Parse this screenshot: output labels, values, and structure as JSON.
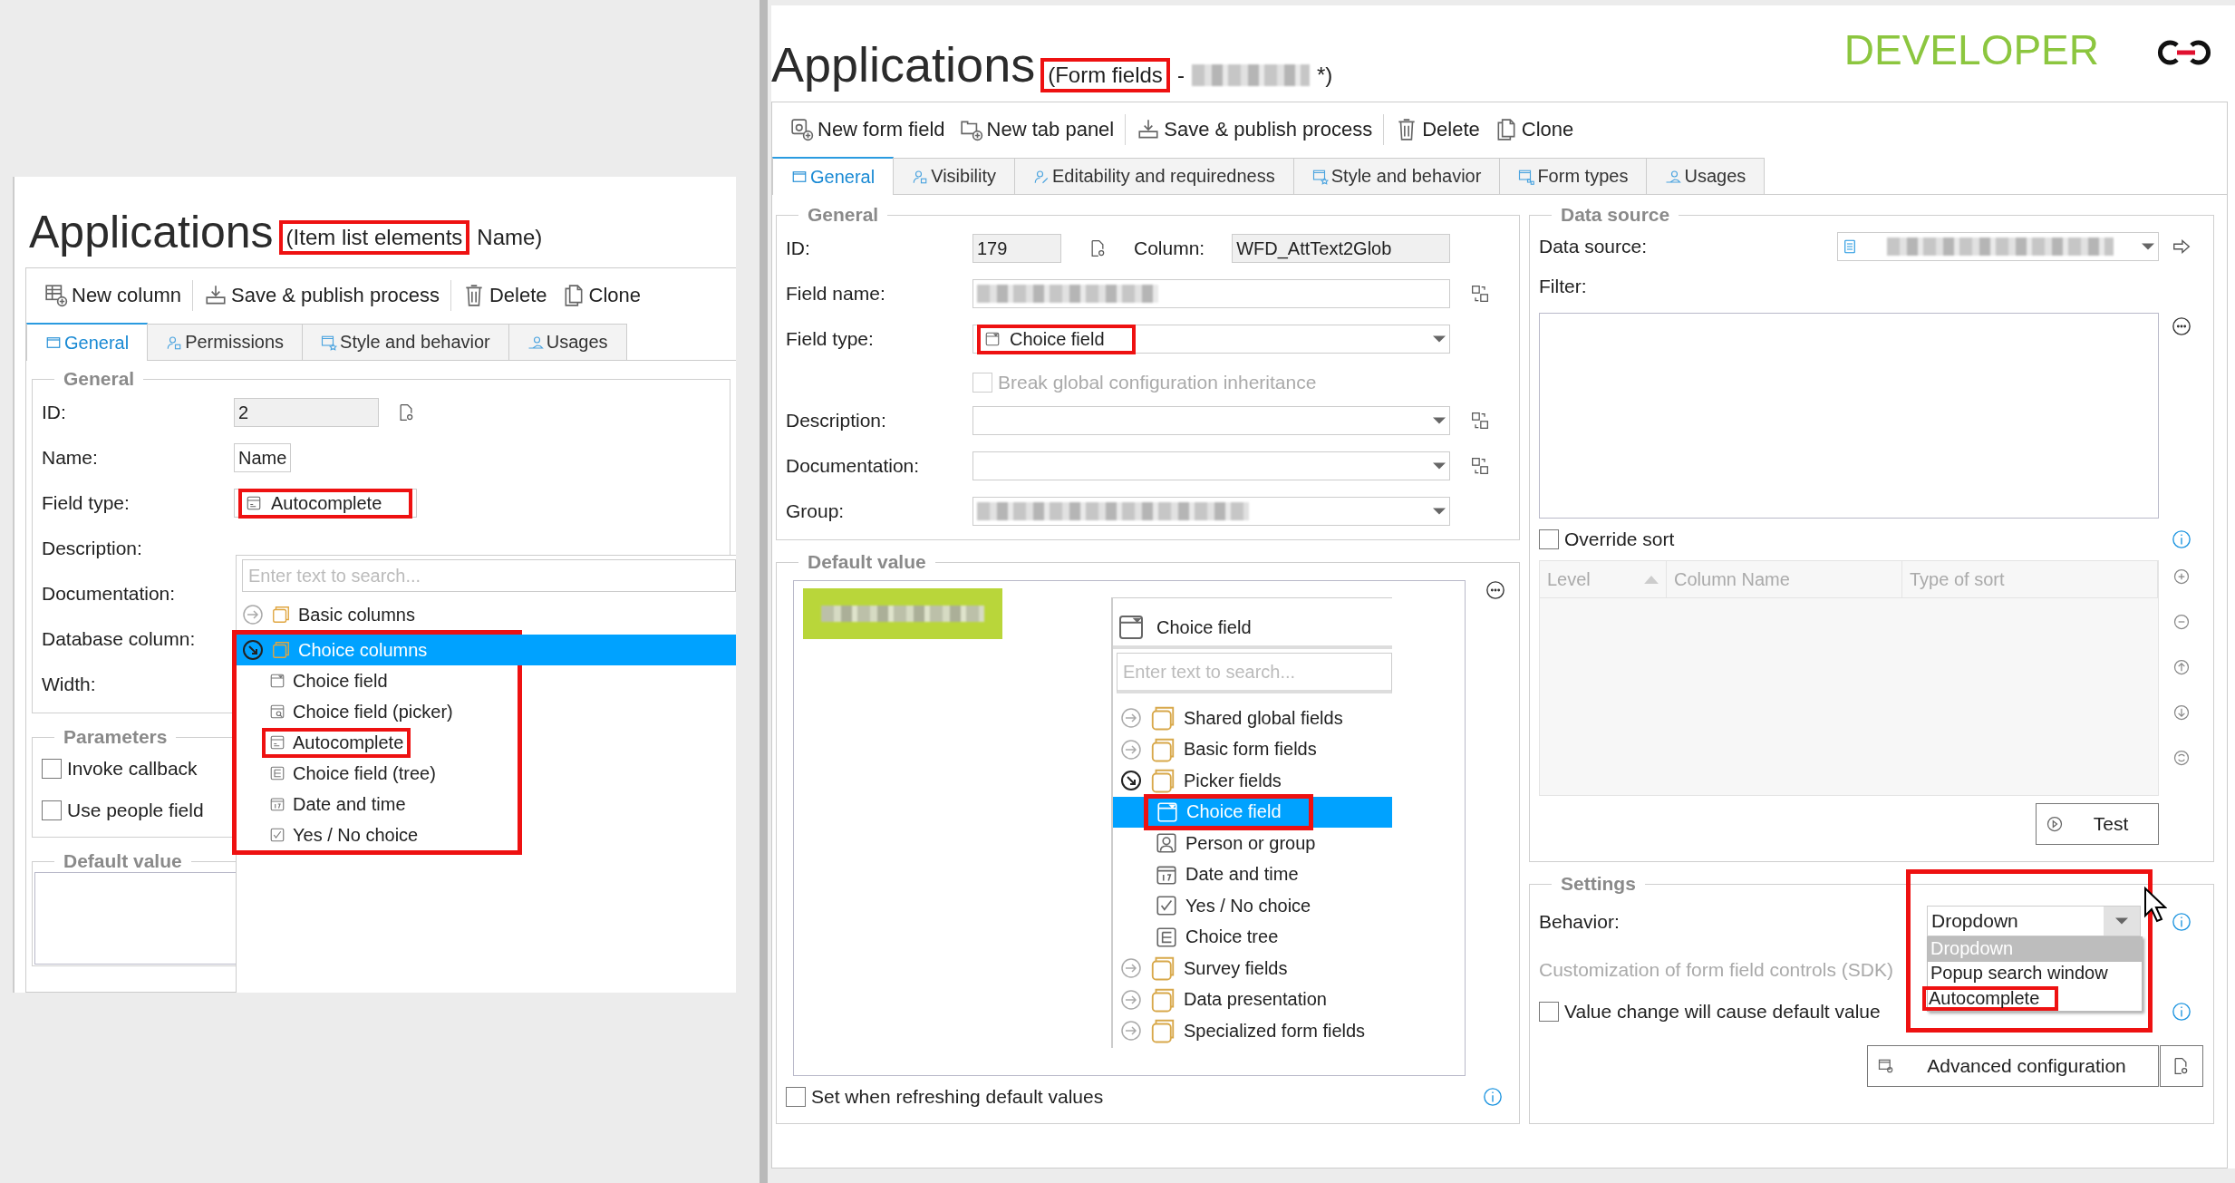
{
  "left": {
    "title": "Applications",
    "subtitle": [
      {
        "kind": "text",
        "text": "(Item list elements",
        "highlighted": true
      },
      {
        "kind": "text",
        "text": "Name)",
        "highlighted": false
      }
    ],
    "toolbar": [
      [
        {
          "label": "New column"
        }
      ],
      [
        {
          "label": "Save & publish process"
        }
      ],
      [
        {
          "label": "Delete"
        },
        {
          "label": "Clone"
        }
      ]
    ],
    "tabs": [
      {
        "label": "General",
        "selected": true
      },
      {
        "label": "Permissions",
        "selected": false
      },
      {
        "label": "Style and behavior",
        "selected": false
      },
      {
        "label": "Usages",
        "selected": false
      }
    ],
    "general": {
      "title": "General",
      "rows": [
        {
          "kind": "id",
          "label": "ID:",
          "field": {
            "kind": "readonly",
            "value": "2"
          }
        },
        {
          "kind": "field",
          "label": "Name:",
          "field": {
            "kind": "text",
            "value": "Name"
          }
        },
        {
          "kind": "field",
          "label": "Field type:",
          "field": {
            "kind": "combo",
            "value": "Autocomplete",
            "highlighted": true
          }
        },
        {
          "kind": "field",
          "label": "Description:"
        },
        {
          "kind": "field",
          "label": "Documentation:"
        },
        {
          "kind": "field",
          "label": "Database column:"
        },
        {
          "kind": "field",
          "label": "Width:"
        }
      ]
    },
    "parameters": {
      "title": "Parameters",
      "checks": [
        {
          "label": "Invoke callback",
          "checked": false
        },
        {
          "label": "Use people field",
          "checked": false
        }
      ]
    },
    "default_value": {
      "title": "Default value"
    },
    "dropdown": {
      "placeholder": "Enter text to search...",
      "tree": [
        {
          "label": "Basic columns",
          "expanded": false,
          "selected": false,
          "highlighted": false
        },
        {
          "label": "Choice columns",
          "expanded": true,
          "selected": true,
          "highlighted": true,
          "children": [
            {
              "label": "Choice field",
              "highlighted": false
            },
            {
              "label": "Choice field (picker)",
              "highlighted": false
            },
            {
              "label": "Autocomplete",
              "highlighted": true
            },
            {
              "label": "Choice field (tree)",
              "highlighted": false
            },
            {
              "label": "Date and time",
              "highlighted": false
            },
            {
              "label": "Yes / No choice",
              "highlighted": false
            }
          ]
        }
      ]
    }
  },
  "right": {
    "title": "Applications",
    "subtitle": [
      {
        "kind": "text",
        "text": "(Form fields",
        "highlighted": true
      },
      {
        "kind": "text",
        "text": "-",
        "highlighted": false
      },
      {
        "kind": "redacted"
      },
      {
        "kind": "text",
        "text": "*)",
        "highlighted": false
      }
    ],
    "brand": "DEVELOPER",
    "toolbar": [
      [
        {
          "label": "New form field"
        },
        {
          "label": "New tab panel"
        }
      ],
      [
        {
          "label": "Save & publish process"
        }
      ],
      [
        {
          "label": "Delete"
        },
        {
          "label": "Clone"
        }
      ]
    ],
    "tabs": [
      {
        "label": "General",
        "selected": true
      },
      {
        "label": "Visibility",
        "selected": false
      },
      {
        "label": "Editability and requiredness",
        "selected": false
      },
      {
        "label": "Style and behavior",
        "selected": false
      },
      {
        "label": "Form types",
        "selected": false
      },
      {
        "label": "Usages",
        "selected": false
      }
    ],
    "general": {
      "title": "General",
      "rows": [
        {
          "kind": "id",
          "label": "ID:",
          "field": {
            "kind": "readonly",
            "value": "179"
          },
          "extra": {
            "label": "Column:",
            "value": "WFD_AttText2Glob"
          }
        },
        {
          "kind": "translatable",
          "label": "Field name:",
          "field": {
            "kind": "text",
            "redacted": true
          }
        },
        {
          "kind": "field",
          "label": "Field type:",
          "field": {
            "kind": "combo",
            "value": "Choice field",
            "highlighted": true,
            "arrow": true
          }
        },
        {
          "kind": "checkbox",
          "label": "Break global configuration inheritance",
          "checked": false,
          "disabled": true
        },
        {
          "kind": "translatable",
          "label": "Description:",
          "field": {
            "kind": "combo",
            "arrow": true
          }
        },
        {
          "kind": "translatable",
          "label": "Documentation:",
          "field": {
            "kind": "combo",
            "arrow": true
          }
        },
        {
          "kind": "field",
          "label": "Group:",
          "field": {
            "kind": "combo",
            "redacted": true,
            "arrow": true
          }
        }
      ]
    },
    "default_value": {
      "title": "Default value",
      "value_redacted": true,
      "picker": {
        "header": "Choice field",
        "placeholder": "Enter text to search...",
        "tree": [
          {
            "label": "Shared global fields",
            "expanded": false
          },
          {
            "label": "Basic form fields",
            "expanded": false
          },
          {
            "label": "Picker fields",
            "expanded": true,
            "children": [
              {
                "label": "Choice field",
                "selected": true,
                "highlighted": true
              },
              {
                "label": "Person or group",
                "selected": false,
                "highlighted": false
              },
              {
                "label": "Date and time",
                "selected": false,
                "highlighted": false
              },
              {
                "label": "Yes / No choice",
                "selected": false,
                "highlighted": false
              },
              {
                "label": "Choice tree",
                "selected": false,
                "highlighted": false
              }
            ]
          },
          {
            "label": "Survey fields",
            "expanded": false
          },
          {
            "label": "Data presentation",
            "expanded": false
          },
          {
            "label": "Specialized form fields",
            "expanded": false
          }
        ]
      },
      "check": {
        "label": "Set when refreshing default values",
        "checked": false
      }
    },
    "data_source": {
      "title": "Data source",
      "source_label": "Data source:",
      "source_redacted": true,
      "filter_label": "Filter:",
      "override": {
        "label": "Override sort",
        "checked": false
      },
      "sort_columns": [
        {
          "label": "Level",
          "sort_ascending": true
        },
        {
          "label": "Column Name",
          "sort_ascending": false
        },
        {
          "label": "Type of sort",
          "sort_ascending": false
        }
      ],
      "test": "Test"
    },
    "settings": {
      "title": "Settings",
      "behavior_label": "Behavior:",
      "behavior": {
        "value": "Dropdown",
        "highlighted": true,
        "options": [
          {
            "label": "Dropdown",
            "selected": true,
            "highlighted": false
          },
          {
            "label": "Popup search window",
            "selected": false,
            "highlighted": false
          },
          {
            "label": "Autocomplete",
            "selected": false,
            "highlighted": true
          }
        ]
      },
      "sdk_label": "Customization of form field controls (SDK)",
      "value_change": {
        "label": "Value change will cause default value",
        "checked": false
      },
      "advanced": "Advanced configuration"
    }
  }
}
